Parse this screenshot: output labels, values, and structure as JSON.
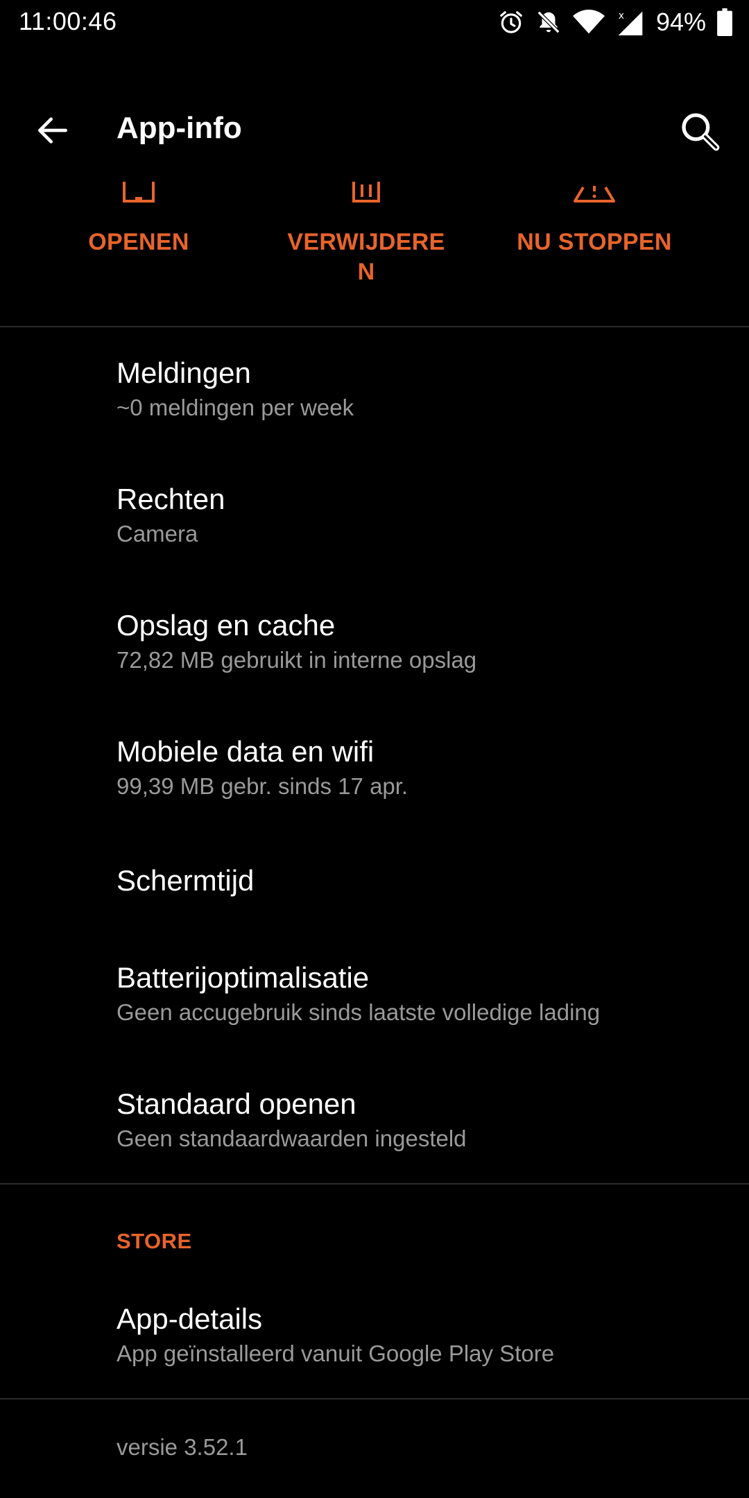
{
  "status_bar": {
    "time": "11:00:46",
    "battery_percent": "94%",
    "icons": [
      "alarm-icon",
      "notifications-off-icon",
      "wifi-icon",
      "cellular-signal-icon",
      "battery-icon"
    ]
  },
  "app_bar": {
    "title": "App-info",
    "back_icon": "arrow-back-icon",
    "search_icon": "search-icon"
  },
  "actions": [
    {
      "label": "OPENEN",
      "icon": "open-icon"
    },
    {
      "label": "VERWIJDEREN",
      "icon": "delete-icon"
    },
    {
      "label": "NU STOPPEN",
      "icon": "warning-icon"
    }
  ],
  "list": [
    {
      "title": "Meldingen",
      "subtitle": "~0 meldingen per week"
    },
    {
      "title": "Rechten",
      "subtitle": "Camera"
    },
    {
      "title": "Opslag en cache",
      "subtitle": "72,82 MB gebruikt in interne opslag"
    },
    {
      "title": "Mobiele data en wifi",
      "subtitle": "99,39 MB gebr. sinds 17 apr."
    },
    {
      "title": "Schermtijd"
    },
    {
      "title": "Batterijoptimalisatie",
      "subtitle": "Geen accugebruik sinds laatste volledige lading"
    },
    {
      "title": "Standaard openen",
      "subtitle": "Geen standaardwaarden ingesteld"
    }
  ],
  "store": {
    "header": "STORE",
    "item": {
      "title": "App-details",
      "subtitle": "App geïnstalleerd vanuit Google Play Store"
    }
  },
  "version": "versie 3.52.1",
  "colors": {
    "accent": "#e8642b",
    "background": "#000000",
    "text_primary": "#ffffff",
    "text_secondary": "#9a9a9a",
    "divider": "#2b2b2b"
  }
}
